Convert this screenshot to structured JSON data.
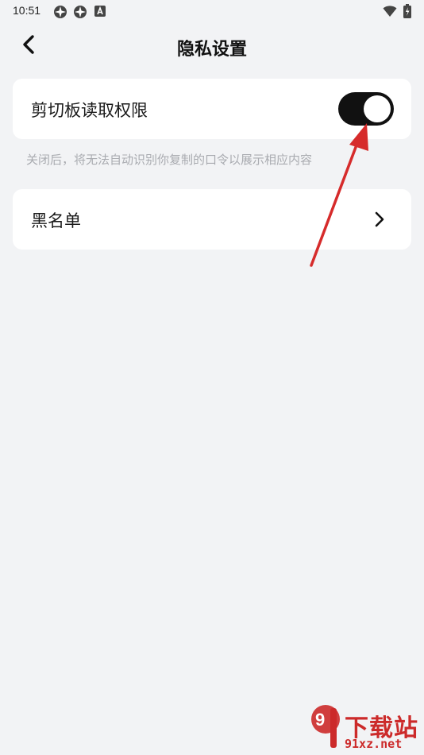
{
  "status_bar": {
    "time": "10:51",
    "icons": [
      "app-notification-icon",
      "app-notification-icon",
      "a-notification-icon"
    ],
    "wifi": "wifi-icon",
    "battery": "battery-charging-icon"
  },
  "header": {
    "back_icon": "chevron-left-icon",
    "title": "隐私设置"
  },
  "settings": {
    "clipboard": {
      "label": "剪切板读取权限",
      "toggle_on": true,
      "hint": "关闭后，将无法自动识别你复制的口令以展示相应内容"
    },
    "blacklist": {
      "label": "黑名单",
      "icon": "chevron-right-icon"
    }
  },
  "annotation": {
    "color": "#d62b2b"
  },
  "watermark": {
    "title": "下载站",
    "url": "91xz.net",
    "color": "#cc2a2a"
  }
}
